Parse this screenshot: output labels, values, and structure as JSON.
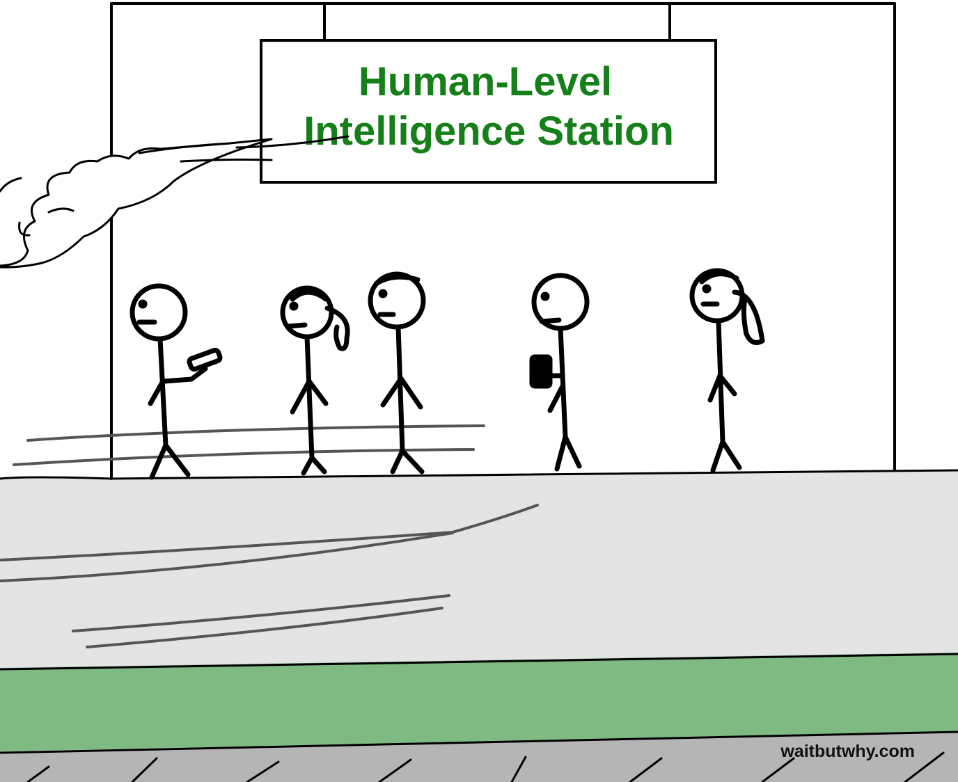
{
  "sign": {
    "line1": "Human-Level",
    "line2": "Intelligence Station"
  },
  "credit": "waitbutwhy.com",
  "colors": {
    "sign_text": "#15801a",
    "platform": "#e4e4e4",
    "train_stripe": "#7fba82",
    "track": "#b5b5b5",
    "ink": "#000000"
  }
}
